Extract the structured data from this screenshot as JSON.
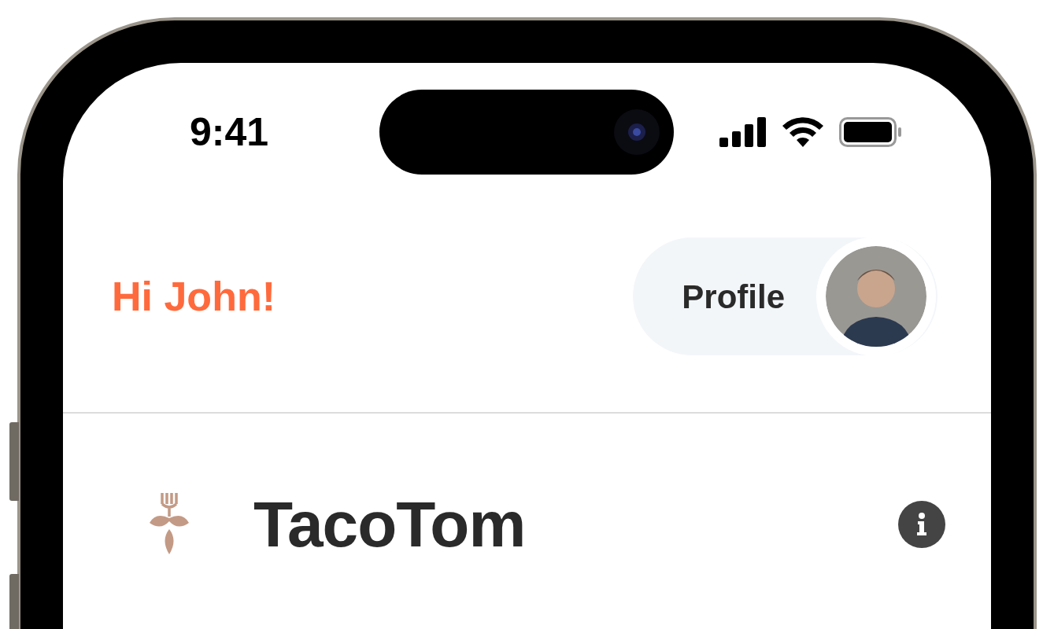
{
  "status_bar": {
    "time": "9:41"
  },
  "header": {
    "greeting": "Hi John!",
    "profile_button": {
      "label": "Profile"
    }
  },
  "restaurant": {
    "name": "TacoTom"
  }
}
